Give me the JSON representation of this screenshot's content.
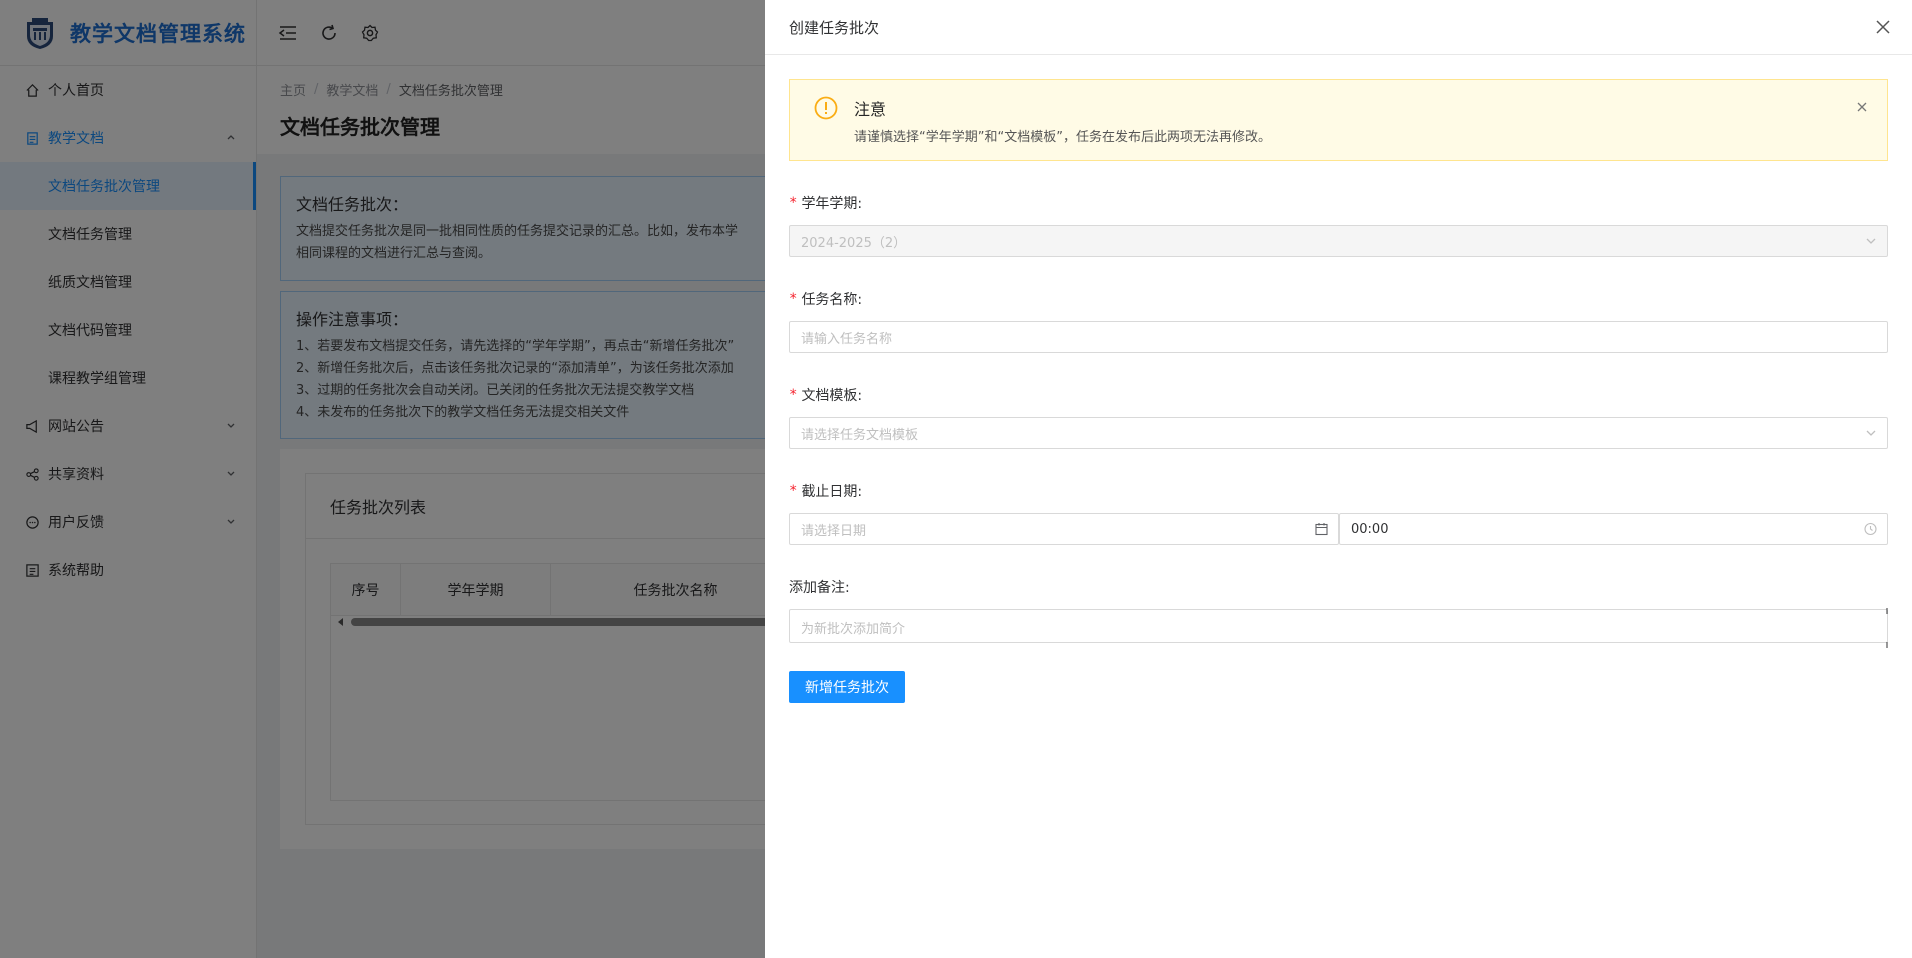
{
  "app": {
    "title": "教学文档管理系统",
    "logo_icon": "university-logo"
  },
  "sidebar": {
    "items": [
      {
        "label": "个人首页",
        "icon": "home-icon"
      },
      {
        "label": "教学文档",
        "icon": "document-icon",
        "expanded": true
      },
      {
        "label": "网站公告",
        "icon": "megaphone-icon"
      },
      {
        "label": "共享资料",
        "icon": "share-icon"
      },
      {
        "label": "用户反馈",
        "icon": "chat-icon"
      },
      {
        "label": "系统帮助",
        "icon": "help-doc-icon"
      }
    ],
    "sub_items": [
      {
        "label": "文档任务批次管理",
        "active": true
      },
      {
        "label": "文档任务管理"
      },
      {
        "label": "纸质文档管理"
      },
      {
        "label": "文档代码管理"
      },
      {
        "label": "课程教学组管理"
      }
    ]
  },
  "header": {
    "icons": [
      "menu-fold-icon",
      "refresh-icon",
      "settings-icon"
    ]
  },
  "breadcrumb": [
    "主页",
    "教学文档",
    "文档任务批次管理"
  ],
  "page_title": "文档任务批次管理",
  "info1": {
    "title": "文档任务批次：",
    "lines": [
      "文档提交任务批次是同一批相同性质的任务提交记录的汇总。比如，发布本学",
      "相同课程的文档进行汇总与查阅。"
    ]
  },
  "info2": {
    "title": "操作注意事项：",
    "lines": [
      "1、若要发布文档提交任务，请先选择的“学年学期”，再点击“新增任务批次”",
      "2、新增任务批次后，点击该任务批次记录的“添加清单”，为该任务批次添加",
      "3、过期的任务批次会自动关闭。已关闭的任务批次无法提交教学文档",
      "4、未发布的任务批次下的教学文档任务无法提交相关文件"
    ]
  },
  "list": {
    "title": "任务批次列表",
    "columns": [
      "序号",
      "学年学期",
      "任务批次名称"
    ]
  },
  "drawer": {
    "title": "创建任务批次",
    "alert": {
      "title": "注意",
      "desc": "请谨慎选择“学年学期”和“文档模板”，任务在发布后此两项无法再修改。"
    },
    "fields": {
      "term_label": "学年学期:",
      "term_value": "2024-2025（2）",
      "name_label": "任务名称:",
      "name_placeholder": "请输入任务名称",
      "template_label": "文档模板:",
      "template_placeholder": "请选择任务文档模板",
      "deadline_label": "截止日期:",
      "date_placeholder": "请选择日期",
      "time_value": "00:00",
      "note_label": "添加备注:",
      "note_placeholder": "为新批次添加简介"
    },
    "submit_label": "新增任务批次"
  },
  "colors": {
    "accent": "#1890ff",
    "logo_text": "#1f6fd1",
    "required": "#f5222d",
    "alert_bg": "#fffbe6",
    "alert_icon": "#faad14"
  }
}
